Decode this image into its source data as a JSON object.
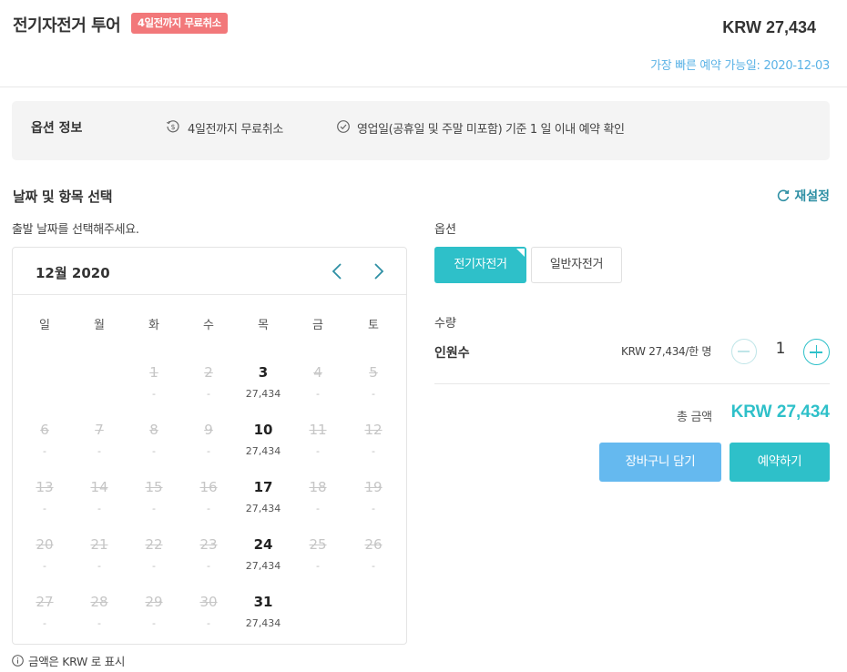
{
  "header": {
    "title": "전기자전거 투어",
    "badge": "4일전까지 무료취소",
    "price": "KRW 27,434",
    "earliest_booking": "가장 빠른 예약 가능일: 2020-12-03"
  },
  "option_info": {
    "label": "옵션 정보",
    "items": [
      {
        "icon": "refund-icon",
        "text": "4일전까지 무료취소"
      },
      {
        "icon": "check-circle-icon",
        "text": "영업일(공휴일 및 주말 미포함) 기준 1 일 이내 예약 확인"
      }
    ]
  },
  "section": {
    "title": "날짜 및 항목 선택",
    "reset_label": "재설정"
  },
  "calendar": {
    "hint": "출발 날짜를 선택해주세요.",
    "month_label": "12월 2020",
    "weekdays": [
      "일",
      "월",
      "화",
      "수",
      "목",
      "금",
      "토"
    ],
    "weeks": [
      [
        null,
        null,
        {
          "d": "1",
          "p": "-",
          "a": false
        },
        {
          "d": "2",
          "p": "-",
          "a": false
        },
        {
          "d": "3",
          "p": "27,434",
          "a": true
        },
        {
          "d": "4",
          "p": "-",
          "a": false
        },
        {
          "d": "5",
          "p": "-",
          "a": false
        }
      ],
      [
        {
          "d": "6",
          "p": "-",
          "a": false
        },
        {
          "d": "7",
          "p": "-",
          "a": false
        },
        {
          "d": "8",
          "p": "-",
          "a": false
        },
        {
          "d": "9",
          "p": "-",
          "a": false
        },
        {
          "d": "10",
          "p": "27,434",
          "a": true
        },
        {
          "d": "11",
          "p": "-",
          "a": false
        },
        {
          "d": "12",
          "p": "-",
          "a": false
        }
      ],
      [
        {
          "d": "13",
          "p": "-",
          "a": false
        },
        {
          "d": "14",
          "p": "-",
          "a": false
        },
        {
          "d": "15",
          "p": "-",
          "a": false
        },
        {
          "d": "16",
          "p": "-",
          "a": false
        },
        {
          "d": "17",
          "p": "27,434",
          "a": true
        },
        {
          "d": "18",
          "p": "-",
          "a": false
        },
        {
          "d": "19",
          "p": "-",
          "a": false
        }
      ],
      [
        {
          "d": "20",
          "p": "-",
          "a": false
        },
        {
          "d": "21",
          "p": "-",
          "a": false
        },
        {
          "d": "22",
          "p": "-",
          "a": false
        },
        {
          "d": "23",
          "p": "-",
          "a": false
        },
        {
          "d": "24",
          "p": "27,434",
          "a": true
        },
        {
          "d": "25",
          "p": "-",
          "a": false
        },
        {
          "d": "26",
          "p": "-",
          "a": false
        }
      ],
      [
        {
          "d": "27",
          "p": "-",
          "a": false
        },
        {
          "d": "28",
          "p": "-",
          "a": false
        },
        {
          "d": "29",
          "p": "-",
          "a": false
        },
        {
          "d": "30",
          "p": "-",
          "a": false
        },
        {
          "d": "31",
          "p": "27,434",
          "a": true
        },
        null,
        null
      ]
    ],
    "footnote": "금액은 KRW 로 표시"
  },
  "options": {
    "label": "옵션",
    "choices": [
      "전기자전거",
      "일반자전거"
    ],
    "selected": "전기자전거"
  },
  "quantity": {
    "label": "수량",
    "person_label": "인원수",
    "unit_price": "KRW 27,434/한 명",
    "value": "1"
  },
  "total": {
    "label": "총 금액",
    "price": "KRW 27,434"
  },
  "actions": {
    "cart_label": "장바구니 담기",
    "book_label": "예약하기"
  },
  "colors": {
    "accent": "#2ec0c9",
    "badge": "#f2787a",
    "cart": "#65b9ef",
    "link": "#5ab2e6"
  }
}
